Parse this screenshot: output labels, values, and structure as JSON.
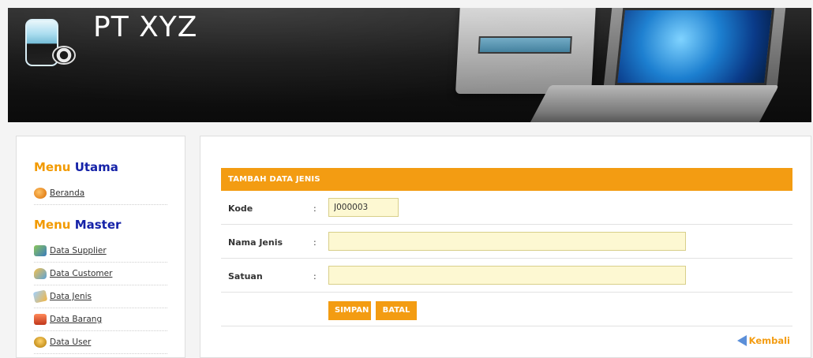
{
  "header": {
    "brand": "PT XYZ"
  },
  "sidebar": {
    "menu_utama": {
      "word1": "Menu",
      "word2": "Utama"
    },
    "utama_items": [
      {
        "label": "Beranda",
        "icon": "home-icon"
      }
    ],
    "menu_master": {
      "word1": "Menu",
      "word2": "Master"
    },
    "master_items": [
      {
        "label": "Data Supplier",
        "icon": "supplier-icon"
      },
      {
        "label": "Data Customer",
        "icon": "customer-icon"
      },
      {
        "label": "Data Jenis",
        "icon": "jenis-icon"
      },
      {
        "label": "Data Barang",
        "icon": "barang-icon"
      },
      {
        "label": "Data User",
        "icon": "user-icon"
      }
    ]
  },
  "form": {
    "title": "TAMBAH DATA JENIS",
    "fields": [
      {
        "label": "Kode",
        "colon": ":",
        "value": "J000003"
      },
      {
        "label": "Nama Jenis",
        "colon": ":",
        "value": ""
      },
      {
        "label": "Satuan",
        "colon": ":",
        "value": ""
      }
    ],
    "buttons": {
      "save": "SIMPAN",
      "cancel": "BATAL"
    },
    "back_link": "Kembali"
  },
  "colors": {
    "accent_orange": "#f39c12",
    "menu_orange": "#f29a00",
    "menu_blue": "#1522a8",
    "input_bg": "#fdf8d2"
  }
}
